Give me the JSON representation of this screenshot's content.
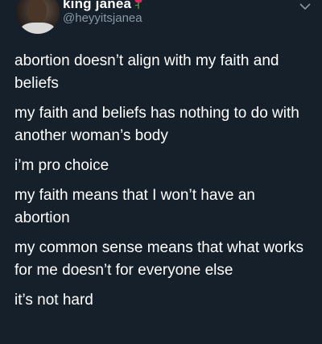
{
  "author": {
    "display_name": "king janea",
    "handle": "@heyyitsjanea",
    "name_emoji_icon": "rose-emoji-icon"
  },
  "menu_icon": "chevron-down-icon",
  "tweet": {
    "lines": [
      "abortion doesn’t align with my faith and beliefs",
      "my faith and beliefs has nothing to do with another woman’s body",
      "i’m pro choice",
      "my faith means that I won’t have an abortion",
      "my common sense means that what works for me doesn’t for everyone else",
      "it’s not hard"
    ]
  },
  "colors": {
    "background": "#15202b",
    "text": "#ffffff",
    "secondary_text": "#8899a6"
  }
}
